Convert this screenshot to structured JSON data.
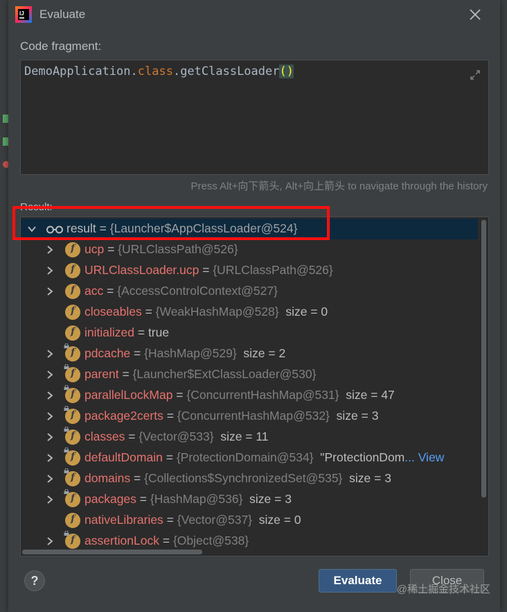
{
  "dialog": {
    "title": "Evaluate",
    "code_label": "Code fragment:",
    "code": {
      "part1": "DemoApplication.",
      "kw": "class",
      "part2": ".getClassLoader",
      "parens": "()"
    },
    "hint": "Press Alt+向下箭头, Alt+向上箭头 to navigate through the history",
    "result_label": "Result:",
    "result": {
      "name": "result",
      "eq": " = ",
      "ref": "{Launcher$AppClassLoader@524}"
    },
    "fields": [
      {
        "name": "ucp",
        "ref": "{URLClassPath@526}",
        "extra": "",
        "expandable": true,
        "locked": false
      },
      {
        "name": "URLClassLoader.ucp",
        "ref": "{URLClassPath@526}",
        "extra": "",
        "expandable": true,
        "locked": false
      },
      {
        "name": "acc",
        "ref": "{AccessControlContext@527}",
        "extra": "",
        "expandable": true,
        "locked": false
      },
      {
        "name": "closeables",
        "ref": "{WeakHashMap@528}",
        "extra": "size = 0",
        "expandable": false,
        "locked": false
      },
      {
        "name": "initialized",
        "ref": "",
        "extra": "true",
        "expandable": false,
        "locked": false
      },
      {
        "name": "pdcache",
        "ref": "{HashMap@529}",
        "extra": "size = 2",
        "expandable": true,
        "locked": true
      },
      {
        "name": "parent",
        "ref": "{Launcher$ExtClassLoader@530}",
        "extra": "",
        "expandable": true,
        "locked": true
      },
      {
        "name": "parallelLockMap",
        "ref": "{ConcurrentHashMap@531}",
        "extra": "size = 47",
        "expandable": true,
        "locked": true
      },
      {
        "name": "package2certs",
        "ref": "{ConcurrentHashMap@532}",
        "extra": "size = 3",
        "expandable": true,
        "locked": true
      },
      {
        "name": "classes",
        "ref": "{Vector@533}",
        "extra": "size = 11",
        "expandable": true,
        "locked": true
      },
      {
        "name": "defaultDomain",
        "ref": "{ProtectionDomain@534}",
        "extra": "\"ProtectionDom",
        "view": "... View",
        "expandable": true,
        "locked": true
      },
      {
        "name": "domains",
        "ref": "{Collections$SynchronizedSet@535}",
        "extra": "size = 3",
        "expandable": true,
        "locked": true
      },
      {
        "name": "packages",
        "ref": "{HashMap@536}",
        "extra": "size = 3",
        "expandable": true,
        "locked": true
      },
      {
        "name": "nativeLibraries",
        "ref": "{Vector@537}",
        "extra": "size = 0",
        "expandable": false,
        "locked": false
      },
      {
        "name": "assertionLock",
        "ref": "{Object@538}",
        "extra": "",
        "expandable": true,
        "locked": true
      }
    ],
    "buttons": {
      "evaluate": "Evaluate",
      "close": "Close",
      "help": "?"
    }
  },
  "watermark": "@稀土掘金技术社区",
  "colors": {
    "dialog_bg": "#3c3f41",
    "editor_bg": "#2b2b2b",
    "selection": "#0d293e",
    "field_name": "#e5736e",
    "highlight": "#ff1010",
    "primary_button": "#365880"
  }
}
